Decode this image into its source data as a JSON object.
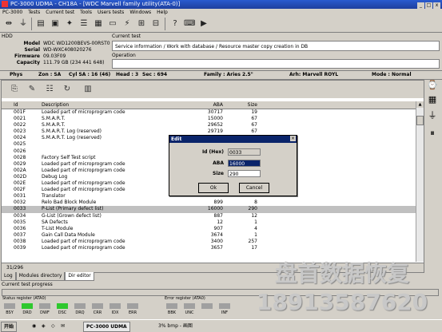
{
  "window": {
    "title": "PC-3000 UDMA - CH18A - [WDC Marvell family utility(ATA-0)]",
    "controls": [
      "_",
      "□",
      "x"
    ]
  },
  "menu": [
    "PC-3000",
    "Tests",
    "Current test",
    "Tools",
    "Users tests",
    "Windows",
    "Help"
  ],
  "hdd": {
    "header": "HDD",
    "fields": [
      {
        "label": "Model",
        "value": "WDC WD1200BEVS-00RST0"
      },
      {
        "label": "Serial",
        "value": "WD-WXC408020276"
      },
      {
        "label": "Firmware",
        "value": "09.03F09"
      },
      {
        "label": "Capacity",
        "value": "111.79 GB (234 441 648)"
      }
    ]
  },
  "current_test": {
    "label": "Current test",
    "value": "Service information / Work with database / Resource master copy creation in DB",
    "operation_label": "Operation",
    "operation_value": ""
  },
  "phys": {
    "label": "Phys",
    "zone": "Zon : SA",
    "cyl": "Cyl SA : 16 (46)",
    "head": "Head : 3",
    "sec": "Sec : 694",
    "family": "Family : Aries 2.5\"",
    "arh": "Arh: Marvell ROYL",
    "mode": "Mode : Normal"
  },
  "table": {
    "columns": [
      "Id",
      "Description",
      "ABA",
      "Size"
    ],
    "rows": [
      {
        "id": "001F",
        "desc": "Loaded part of microprogram code",
        "aba": "30717",
        "size": "19"
      },
      {
        "id": "0021",
        "desc": "S.M.A.R.T.",
        "aba": "15000",
        "size": "67"
      },
      {
        "id": "0022",
        "desc": "S.M.A.R.T.",
        "aba": "29652",
        "size": "67"
      },
      {
        "id": "0023",
        "desc": "S.M.A.R.T. Log (reserved)",
        "aba": "29719",
        "size": "67"
      },
      {
        "id": "0024",
        "desc": "S.M.A.R.T. Log (reserved)",
        "aba": "",
        "size": ""
      },
      {
        "id": "0025",
        "desc": "",
        "aba": "",
        "size": ""
      },
      {
        "id": "0026",
        "desc": "",
        "aba": "",
        "size": ""
      },
      {
        "id": "0028",
        "desc": "Factory Self Test script",
        "aba": "",
        "size": ""
      },
      {
        "id": "0029",
        "desc": "Loaded part of microprogram code",
        "aba": "",
        "size": ""
      },
      {
        "id": "002A",
        "desc": "Loaded part of microprogram code",
        "aba": "",
        "size": ""
      },
      {
        "id": "002D",
        "desc": "Debug Log",
        "aba": "",
        "size": ""
      },
      {
        "id": "002E",
        "desc": "Loaded part of microprogram code",
        "aba": "",
        "size": ""
      },
      {
        "id": "002F",
        "desc": "Loaded part of microprogram code",
        "aba": "",
        "size": ""
      },
      {
        "id": "0031",
        "desc": "Translator",
        "aba": "707",
        "size": "176"
      },
      {
        "id": "0032",
        "desc": "Relo Bad Block Module",
        "aba": "899",
        "size": "8"
      },
      {
        "id": "0033",
        "desc": "P-List (Primary defect list)",
        "aba": "16000",
        "size": "290"
      },
      {
        "id": "0034",
        "desc": "G-List (Grown defect list)",
        "aba": "887",
        "size": "12"
      },
      {
        "id": "0035",
        "desc": "SA Defects",
        "aba": "12",
        "size": "1"
      },
      {
        "id": "0036",
        "desc": "T-List Module",
        "aba": "907",
        "size": "4"
      },
      {
        "id": "0037",
        "desc": "Gain Call Data Module",
        "aba": "3674",
        "size": "1"
      },
      {
        "id": "0038",
        "desc": "Loaded part of microprogram code",
        "aba": "3400",
        "size": "257"
      },
      {
        "id": "0039",
        "desc": "Loaded part of microprogram code",
        "aba": "3657",
        "size": "17"
      }
    ],
    "selected_index": 15,
    "status": "31/296"
  },
  "tabs": [
    {
      "label": "Log",
      "active": false
    },
    {
      "label": "Modules directory",
      "active": false
    },
    {
      "label": "Dir editor",
      "active": true
    }
  ],
  "progress_label": "Current test progress",
  "status_register": {
    "title": "Status register (ATA0)",
    "bits": [
      {
        "name": "BSY",
        "on": false
      },
      {
        "name": "DRD",
        "on": true
      },
      {
        "name": "DWF",
        "on": false
      },
      {
        "name": "DSC",
        "on": true
      },
      {
        "name": "DRQ",
        "on": false
      },
      {
        "name": "CRR",
        "on": false
      },
      {
        "name": "IDX",
        "on": false
      },
      {
        "name": "ERR",
        "on": false
      }
    ]
  },
  "error_register": {
    "title": "Error register (ATA0)",
    "bits": [
      {
        "name": "BBK",
        "on": false
      },
      {
        "name": "UNC",
        "on": false
      },
      {
        "name": "",
        "on": false
      },
      {
        "name": "INF",
        "on": false
      }
    ]
  },
  "taskbar": {
    "start": "开始",
    "task1": "PC-3000 UDMA",
    "task2": "3% bmp - 画图"
  },
  "dialog": {
    "title": "Edit",
    "fields": [
      {
        "label": "Id (Hex)",
        "value": "0033",
        "state": "readonly"
      },
      {
        "label": "ABA",
        "value": "16000",
        "state": "active"
      },
      {
        "label": "Size",
        "value": "290",
        "state": "normal"
      }
    ],
    "ok_label": "Ok",
    "cancel_label": "Cancel"
  },
  "watermark": {
    "line1": "盘首数据恢复",
    "line2": "18913587620"
  },
  "colors": {
    "title_bg": "#1e3f9e",
    "panel_bg": "#d4d0c8",
    "register_on": "#2ec82e",
    "register_off": "#a0a0a0",
    "dialog_title": "#0a246a"
  }
}
